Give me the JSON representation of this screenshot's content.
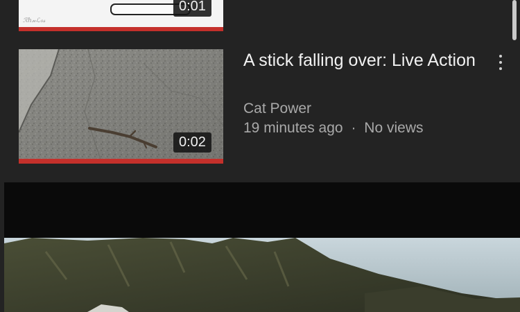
{
  "feed": {
    "previous_video": {
      "duration": "0:01",
      "thumbnail_signature": "ℛℎ𝓃ℒℴ𝓈",
      "watched_fraction": 1.0
    },
    "video": {
      "title": "A stick falling over: Live Action",
      "channel": "Cat Power",
      "upload_age": "19 minutes ago",
      "separator": "·",
      "views": "No views",
      "duration": "0:02",
      "watched_fraction": 1.0,
      "more_icon": "more-vert-icon"
    }
  },
  "colors": {
    "background": "#232323",
    "progress_red": "#c4302b",
    "title_text": "#f2f2f2",
    "secondary_text": "#a9a9a9"
  }
}
